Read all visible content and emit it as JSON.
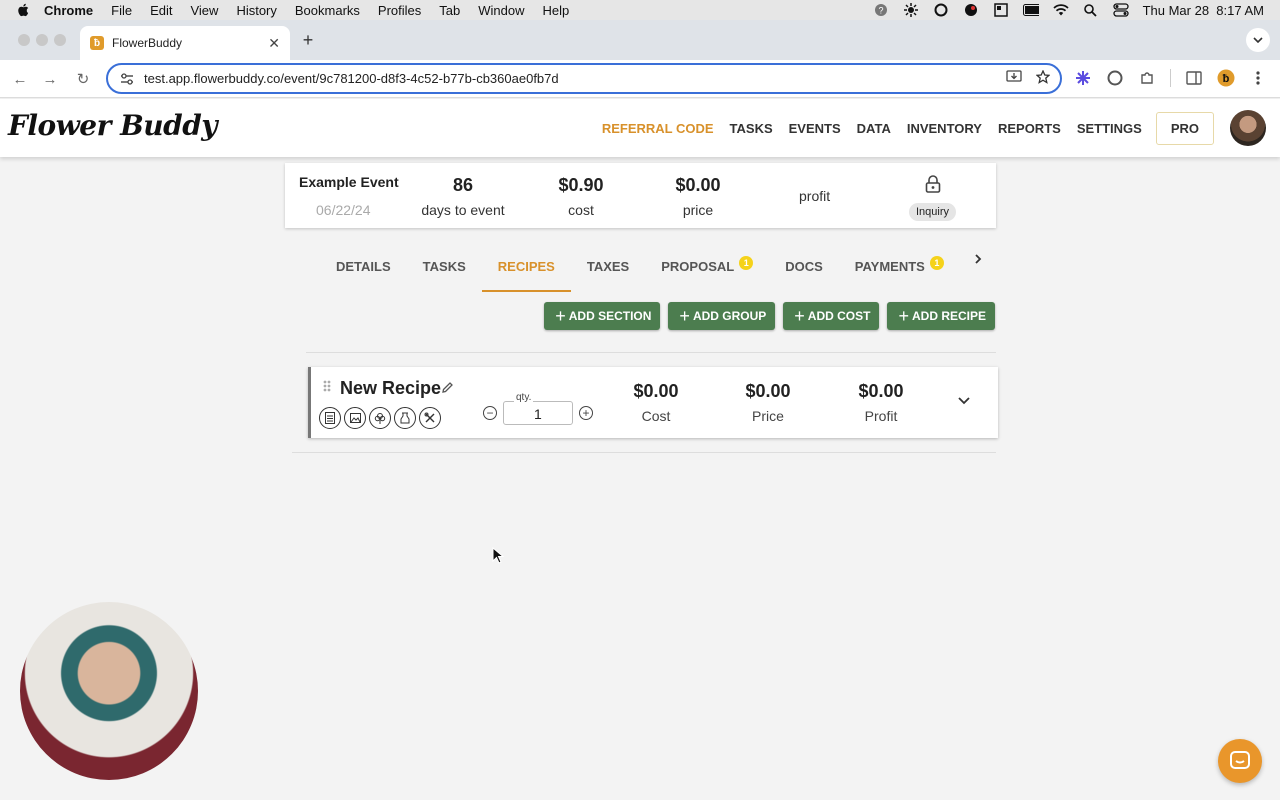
{
  "menubar": {
    "app": "Chrome",
    "items": [
      "File",
      "Edit",
      "View",
      "History",
      "Bookmarks",
      "Profiles",
      "Tab",
      "Window",
      "Help"
    ],
    "datetime": "Thu Mar 28  8:17 AM"
  },
  "browser": {
    "tab_title": "FlowerBuddy",
    "url": "test.app.flowerbuddy.co/event/9c781200-d8f3-4c52-b77b-cb360ae0fb7d"
  },
  "app": {
    "logo": "Flower Buddy",
    "nav": {
      "referral": "REFERRAL CODE",
      "tasks": "TASKS",
      "events": "EVENTS",
      "data": "DATA",
      "inventory": "INVENTORY",
      "reports": "REPORTS",
      "settings": "SETTINGS",
      "pro": "PRO"
    },
    "accent_color": "#d8912b",
    "button_color": "#4c7d4f"
  },
  "event": {
    "name": "Example Event",
    "date": "06/22/24",
    "days_value": "86",
    "days_label": "days to event",
    "cost_value": "$0.90",
    "cost_label": "cost",
    "price_value": "$0.00",
    "price_label": "price",
    "profit_label": "profit",
    "status": "Inquiry"
  },
  "tabs": {
    "details": "DETAILS",
    "tasks": "TASKS",
    "recipes": "RECIPES",
    "taxes": "TAXES",
    "proposal": "PROPOSAL",
    "proposal_badge": "1",
    "docs": "DOCS",
    "payments": "PAYMENTS",
    "payments_badge": "1"
  },
  "actions": {
    "add_section": "ADD SECTION",
    "add_group": "ADD GROUP",
    "add_cost": "ADD COST",
    "add_recipe": "ADD RECIPE"
  },
  "recipe": {
    "name": "New Recipe",
    "qty_label": "qty.",
    "qty_value": "1",
    "cost_value": "$0.00",
    "cost_label": "Cost",
    "price_value": "$0.00",
    "price_label": "Price",
    "profit_value": "$0.00",
    "profit_label": "Profit"
  }
}
